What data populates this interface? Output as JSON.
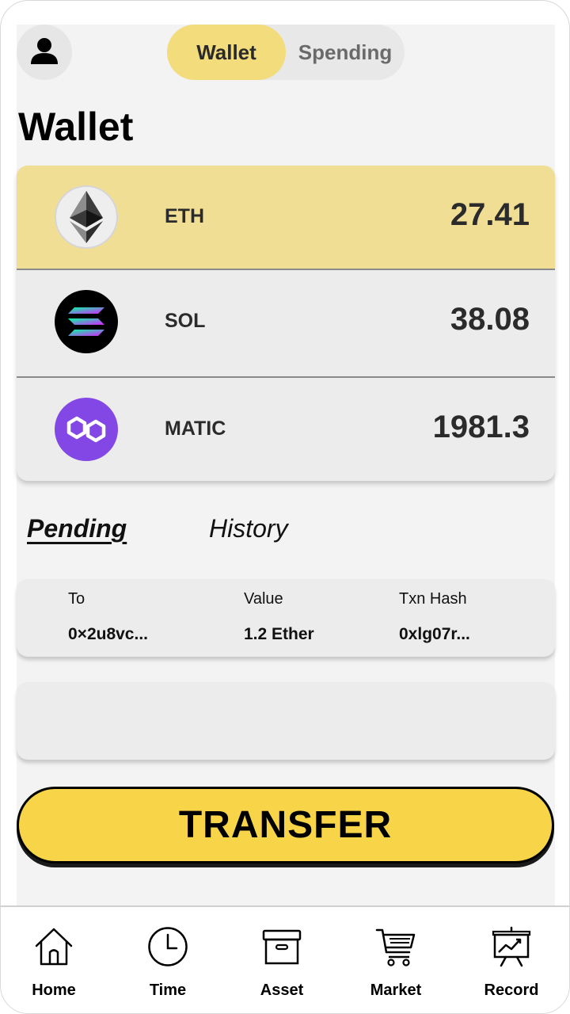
{
  "header": {
    "profile_icon": "user-icon",
    "segments": [
      {
        "label": "Wallet",
        "active": true
      },
      {
        "label": "Spending",
        "active": false
      }
    ]
  },
  "page_title": "Wallet",
  "tokens": [
    {
      "symbol": "ETH",
      "balance": "27.41",
      "icon": "ethereum-icon",
      "selected": true
    },
    {
      "symbol": "SOL",
      "balance": "38.08",
      "icon": "solana-icon",
      "selected": false
    },
    {
      "symbol": "MATIC",
      "balance": "1981.3",
      "icon": "polygon-icon",
      "selected": false
    }
  ],
  "tabs": [
    {
      "label": "Pending",
      "active": true
    },
    {
      "label": "History",
      "active": false
    }
  ],
  "transactions": {
    "headers": [
      "To",
      "Value",
      "Txn Hash"
    ],
    "rows": [
      [
        "0×2u8vc...",
        "1.2 Ether",
        "0xlg07r..."
      ]
    ]
  },
  "transfer_label": "TRANSFER",
  "nav": [
    {
      "label": "Home",
      "icon": "home-icon"
    },
    {
      "label": "Time",
      "icon": "clock-icon"
    },
    {
      "label": "Asset",
      "icon": "box-icon"
    },
    {
      "label": "Market",
      "icon": "cart-icon"
    },
    {
      "label": "Record",
      "icon": "chart-board-icon"
    }
  ],
  "colors": {
    "accent_yellow": "#f8d448",
    "selected_row": "#f1de95",
    "segment_active": "#f3dc7c",
    "polygon_purple": "#8247e5"
  }
}
